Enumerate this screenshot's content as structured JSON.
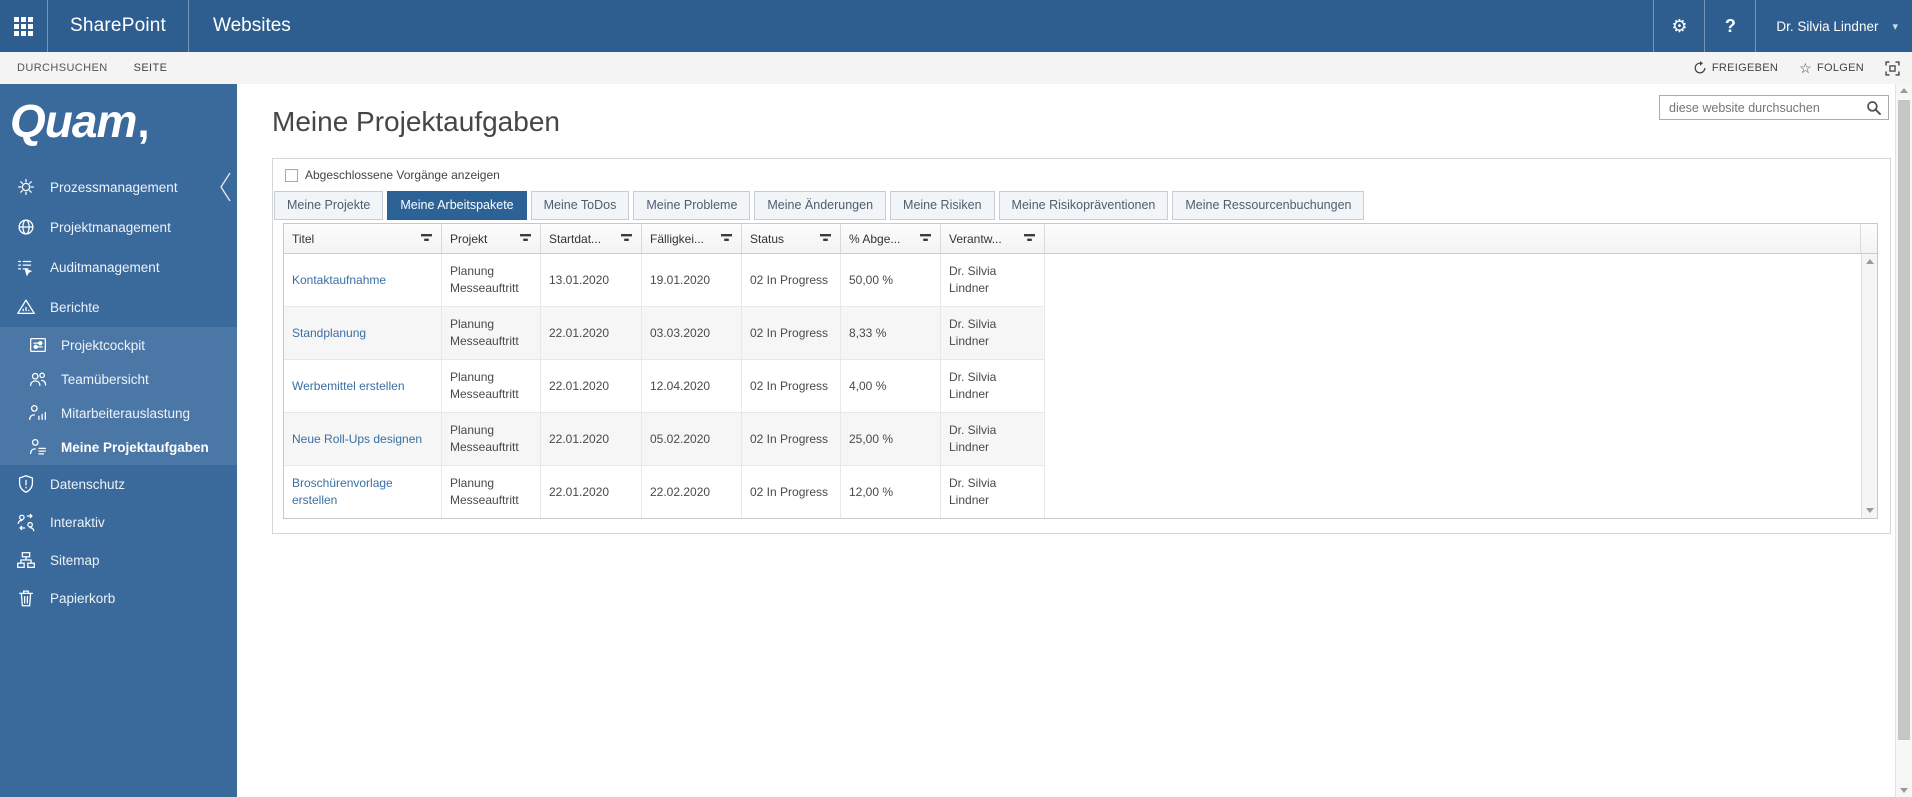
{
  "colors": {
    "suitebar": "#2e5e8f",
    "sidebar": "#3a699c",
    "sidebar_submenu": "#4b77a6",
    "accent_tab": "#2d6296",
    "link": "#3b6ea5"
  },
  "suitebar": {
    "app_name": "SharePoint",
    "section": "Websites",
    "user_name": "Dr. Silvia Lindner",
    "help_label": "?"
  },
  "icons": {
    "gear": "⚙",
    "star": "☆",
    "caret": "▾"
  },
  "ribbon": {
    "browse": "DURCHSUCHEN",
    "page": "SEITE",
    "share": "FREIGEBEN",
    "follow": "FOLGEN"
  },
  "sidebar": {
    "logo_text": "Quam",
    "logo_mark": ",",
    "items": [
      {
        "label": "Prozessmanagement"
      },
      {
        "label": "Projektmanagement"
      },
      {
        "label": "Auditmanagement"
      },
      {
        "label": "Berichte"
      },
      {
        "label": "Projektcockpit"
      },
      {
        "label": "Teamübersicht"
      },
      {
        "label": "Mitarbeiterauslastung"
      },
      {
        "label": "Meine Projektaufgaben"
      },
      {
        "label": "Datenschutz"
      },
      {
        "label": "Interaktiv"
      },
      {
        "label": "Sitemap"
      },
      {
        "label": "Papierkorb"
      }
    ]
  },
  "page": {
    "title": "Meine Projektaufgaben",
    "search_placeholder": "diese website durchsuchen"
  },
  "panel": {
    "show_completed_label": "Abgeschlossene Vorgänge anzeigen",
    "show_completed_checked": false
  },
  "tabs": {
    "items": [
      {
        "label": "Meine Projekte"
      },
      {
        "label": "Meine Arbeitspakete",
        "active": true
      },
      {
        "label": "Meine ToDos"
      },
      {
        "label": "Meine Probleme"
      },
      {
        "label": "Meine Änderungen"
      },
      {
        "label": "Meine Risiken"
      },
      {
        "label": "Meine Risikopräventionen"
      },
      {
        "label": "Meine Ressourcenbuchungen"
      }
    ]
  },
  "grid": {
    "columns": [
      {
        "label": "Titel"
      },
      {
        "label": "Projekt"
      },
      {
        "label": "Startdat..."
      },
      {
        "label": "Fälligkei..."
      },
      {
        "label": "Status"
      },
      {
        "label": "% Abge..."
      },
      {
        "label": "Verantw..."
      }
    ],
    "rows": [
      {
        "titel": "Kontaktaufnahme",
        "projekt": "Planung Messeauftritt",
        "start": "13.01.2020",
        "due": "19.01.2020",
        "status": "02 In Progress",
        "pct": "50,00 %",
        "resp": "Dr. Silvia Lindner"
      },
      {
        "titel": "Standplanung",
        "projekt": "Planung Messeauftritt",
        "start": "22.01.2020",
        "due": "03.03.2020",
        "status": "02 In Progress",
        "pct": "8,33 %",
        "resp": "Dr. Silvia Lindner"
      },
      {
        "titel": "Werbemittel erstellen",
        "projekt": "Planung Messeauftritt",
        "start": "22.01.2020",
        "due": "12.04.2020",
        "status": "02 In Progress",
        "pct": "4,00 %",
        "resp": "Dr. Silvia Lindner"
      },
      {
        "titel": "Neue Roll-Ups designen",
        "projekt": "Planung Messeauftritt",
        "start": "22.01.2020",
        "due": "05.02.2020",
        "status": "02 In Progress",
        "pct": "25,00 %",
        "resp": "Dr. Silvia Lindner"
      },
      {
        "titel": "Broschürenvorlage erstellen",
        "projekt": "Planung Messeauftritt",
        "start": "22.01.2020",
        "due": "22.02.2020",
        "status": "02 In Progress",
        "pct": "12,00 %",
        "resp": "Dr. Silvia Lindner"
      }
    ]
  }
}
